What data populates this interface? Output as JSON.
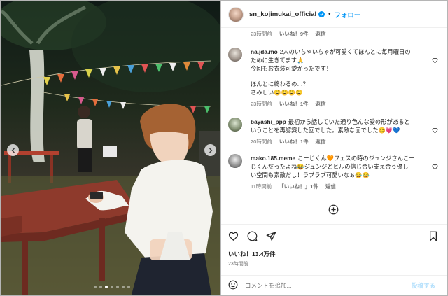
{
  "header": {
    "username": "sn_kojimukai_official",
    "separator": "•",
    "follow_label": "フォロー"
  },
  "top_meta": {
    "time": "23時間前",
    "likes": "いいね！9件",
    "reply": "返信"
  },
  "comments": [
    {
      "user": "na.jda.mo",
      "lines": [
        "2人のいちゃいちゃが可愛くてほんとに毎月曜日の",
        "ために生きてます🙏",
        "今回もお衣装可愛かったです！",
        "",
        "ほんとに終わるの…？",
        "さみしい😩😩😩😩"
      ],
      "time": "23時間前",
      "likes": "いいね！1件",
      "reply": "返信"
    },
    {
      "user": "bayashi_ppp",
      "lines": [
        "最初から話していた通り色んな愛の形があると",
        "いうことを再認識した回でした。素敵な回でした😊💗💙"
      ],
      "time": "20時間前",
      "likes": "いいね！1件",
      "reply": "返信"
    },
    {
      "user": "mako.185.meme",
      "lines": [
        "こーじくん🧡フェスの時のジュンジさんこー",
        "じくんだったよね😂ジュンジとヒルの信じ合い支え合う優し",
        "い空間も素敵だし！ラブラブ可愛いなぁ😂😂"
      ],
      "time": "11時間前",
      "likes": "「いいね！」1件",
      "reply": "返信"
    }
  ],
  "stats": {
    "likes": "いいね！13.4万件",
    "posted": "23時間前"
  },
  "add_comment": {
    "placeholder": "コメントを追加...",
    "post_label": "投稿する"
  },
  "media": {
    "slide_count": 7,
    "active_slide": 3
  },
  "colors": {
    "accent": "#0095f6",
    "muted": "#737373",
    "post_disabled": "#b2dffc"
  },
  "icons": [
    "verified-icon",
    "heart-icon",
    "comment-icon",
    "share-icon",
    "bookmark-icon",
    "emoji-icon",
    "plus-circle-icon",
    "chevron-left-icon",
    "chevron-right-icon"
  ]
}
